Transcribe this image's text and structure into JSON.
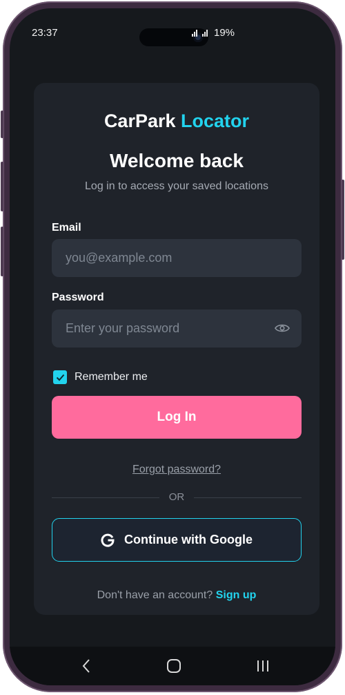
{
  "status_bar": {
    "time": "23:37",
    "battery": "19%"
  },
  "brand": {
    "name": "CarPark",
    "accent": "Locator",
    "accent_color": "#22d3ee"
  },
  "header": {
    "title": "Welcome back",
    "subtitle": "Log in to access your saved locations"
  },
  "form": {
    "email_label": "Email",
    "email_placeholder": "you@example.com",
    "password_label": "Password",
    "password_placeholder": "Enter your password",
    "remember_label": "Remember me",
    "remember_checked": true,
    "login_button": "Log In",
    "forgot_link": "Forgot password?",
    "divider": "OR",
    "google_button": "Continue with Google"
  },
  "footer": {
    "prompt": "Don't have an account?",
    "signup_link": "Sign up"
  },
  "colors": {
    "primary_button": "#ff6b9d",
    "background": "#16191d",
    "card": "#1f232a"
  },
  "icons": [
    "eye-icon",
    "check-icon",
    "google-icon",
    "back-icon",
    "home-icon",
    "recents-icon"
  ]
}
